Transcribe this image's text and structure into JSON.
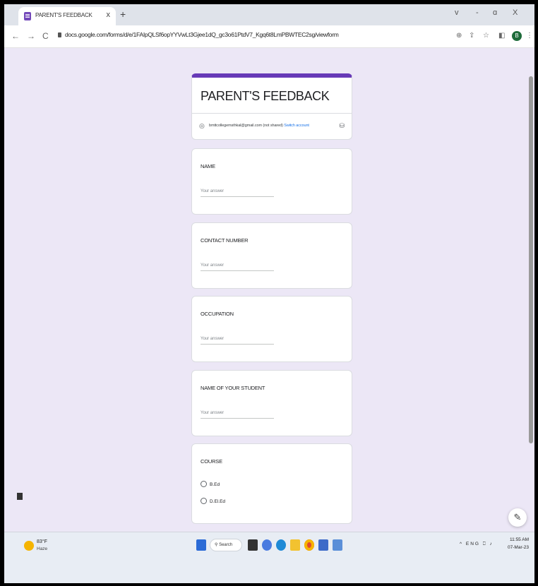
{
  "browser": {
    "tab_title": "PARENT'S FEEDBACK",
    "tab_close": "x",
    "new_tab": "+",
    "url": "docs.google.com/forms/d/e/1FAIpQLSf6opYYVwLt3Gjee1dQ_gc3o61PtdV7_Kgq6t8LmPBWTEC2sg/viewform",
    "nav": {
      "back": "←",
      "forward": "→",
      "reload": "C"
    },
    "window_controls": {
      "chevron": "v",
      "minimize": "-",
      "restore": "ɑ",
      "close": "X"
    },
    "toolbar_icons": {
      "zoom": "⊕",
      "share": "⇪",
      "star": "☆",
      "sidepanel": "◧",
      "menu": "⋮"
    },
    "avatar_letter": "B"
  },
  "form": {
    "title": "PARENT'S FEEDBACK",
    "account_email": "bmttcollegemsthkal@gmail.com",
    "account_note": "(not shared)",
    "switch_account": "Switch account",
    "questions": [
      {
        "label": "NAME",
        "placeholder": "Your answer"
      },
      {
        "label": "CONTACT NUMBER",
        "placeholder": "Your answer"
      },
      {
        "label": "OCCUPATION",
        "placeholder": "Your answer"
      },
      {
        "label": "NAME OF YOUR STUDENT",
        "placeholder": "Your answer"
      }
    ],
    "course": {
      "label": "COURSE",
      "options": [
        "B.Ed",
        "D.El.Ed"
      ]
    },
    "edit_fab": "✎"
  },
  "taskbar": {
    "temperature": "83°F",
    "condition": "Haze",
    "search_label": "Search",
    "tray": "^ ENG",
    "time": "11:55 AM",
    "date": "07-Mar-23"
  },
  "colors": {
    "accent": "#673ab7",
    "page_bg": "#ece7f6",
    "link": "#1a73e8"
  }
}
